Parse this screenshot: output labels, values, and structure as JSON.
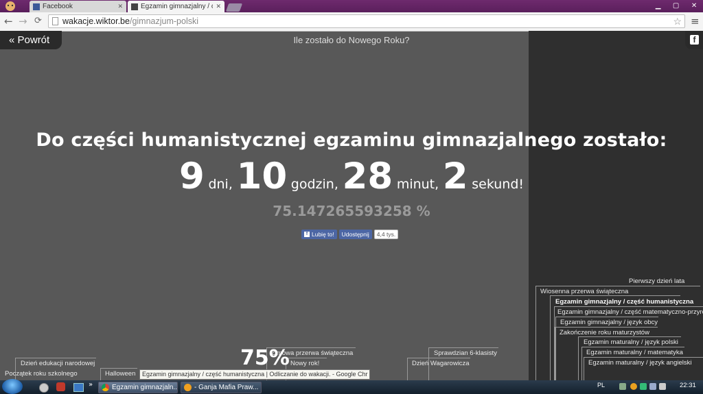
{
  "browser": {
    "tabs": [
      {
        "label": "Facebook",
        "active": false
      },
      {
        "label": "Egzamin gimnazjalny / część",
        "active": true
      }
    ],
    "url_host": "wakacje.wiktor.be",
    "url_path": "/gimnazjum-polski",
    "nav": {
      "back": "←",
      "forward": "→",
      "reload": "C",
      "star": "☆",
      "menu": "≡"
    }
  },
  "page": {
    "back_label": "« Powrót",
    "new_year_link": "Ile zostało do Nowego Roku?",
    "heading": "Do części humanistycznej egzaminu gimnazjalnego zostało:",
    "countdown": {
      "days": "9",
      "days_label": "dni,",
      "hours": "10",
      "hours_label": "godzin,",
      "minutes": "28",
      "minutes_label": "minut,",
      "seconds": "2",
      "seconds_label": "sekund!"
    },
    "percent": "75.147265593258 %",
    "social": {
      "like": "Lubię to!",
      "share": "Udostępnij",
      "count": "4,4 tys."
    }
  },
  "timeline": {
    "right_events": [
      "Pierwszy dzień lata",
      "Wiosenna przerwa świąteczna",
      "Egzamin gimnazjalny / część humanistyczna",
      "Egzamin gimnazjalny / część matematyczno-przyrod",
      "Egzamin gimnazjalny / język obcy",
      "Zakończenie roku maturzystów",
      "Egzamin maturalny / język polski",
      "Egzamin maturalny / matematyka",
      "Egzamin maturalny / język angielski"
    ],
    "left_events": [
      "Dzień edukacji narodowej",
      "Początek roku szkolnego",
      "Halloween",
      "Zimowa przerwa świąteczna",
      "Nowy rok!",
      "Sprawdzian 6-klasisty",
      "Dzień Wagarowicza"
    ],
    "progress_label": "75%"
  },
  "taskbar": {
    "tooltip": "Egzamin gimnazjalny / część humanistyczna | Odliczanie do wakacji. - Google Chr",
    "items": [
      "Egzamin gimnazjaln...",
      "- Ganja Mafia Praw..."
    ],
    "more": "»",
    "lang": "PL",
    "clock": "22:31"
  }
}
